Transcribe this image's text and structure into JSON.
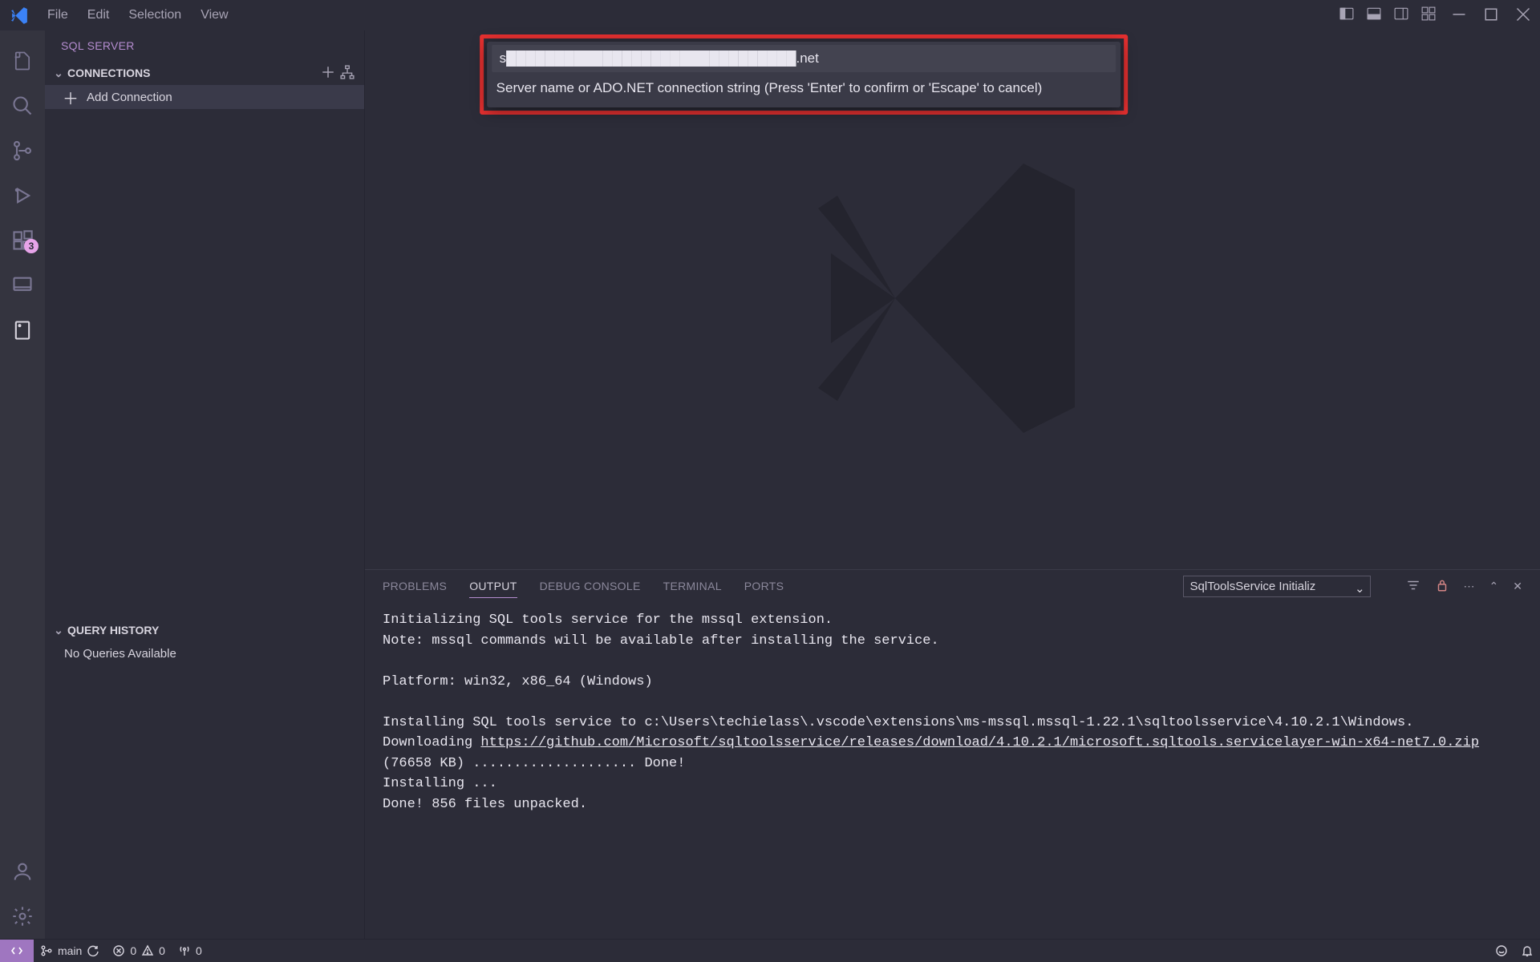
{
  "title_menu": {
    "file": "File",
    "edit": "Edit",
    "selection": "Selection",
    "view": "View"
  },
  "sidebar": {
    "title": "SQL SERVER",
    "connections_label": "CONNECTIONS",
    "add_connection": "Add Connection",
    "history_label": "QUERY HISTORY",
    "history_empty": "No Queries Available"
  },
  "extensions_badge": "3",
  "quick_input": {
    "value": "s██████████████████████████████.net",
    "hint": "Server name or ADO.NET connection string (Press 'Enter' to confirm or 'Escape' to cancel)"
  },
  "panel": {
    "tabs": {
      "problems": "PROBLEMS",
      "output": "OUTPUT",
      "debug": "DEBUG CONSOLE",
      "terminal": "TERMINAL",
      "ports": "PORTS"
    },
    "select_value": "SqlToolsService Initializ",
    "output_lines": {
      "l1": "Initializing SQL tools service for the mssql extension.",
      "l2": "Note: mssql commands will be available after installing the service.",
      "l3": "",
      "l4": "Platform: win32, x86_64 (Windows)",
      "l5": "",
      "l6a": "Installing SQL tools service to c:\\Users\\techielass\\.vscode\\extensions\\ms-mssql.mssql-1.22.1\\sqltoolsservice\\4.10.2.1\\Windows.",
      "l7a": "Downloading ",
      "l7b": "https://github.com/Microsoft/sqltoolsservice/releases/download/4.10.2.1/microsoft.sqltools.servicelayer-win-x64-net7.0.zip",
      "l8": "(76658 KB) .................... Done!",
      "l9": "Installing ...",
      "l10": "Done! 856 files unpacked."
    }
  },
  "statusbar": {
    "branch": "main",
    "errors": "0",
    "warnings": "0",
    "ports": "0"
  }
}
